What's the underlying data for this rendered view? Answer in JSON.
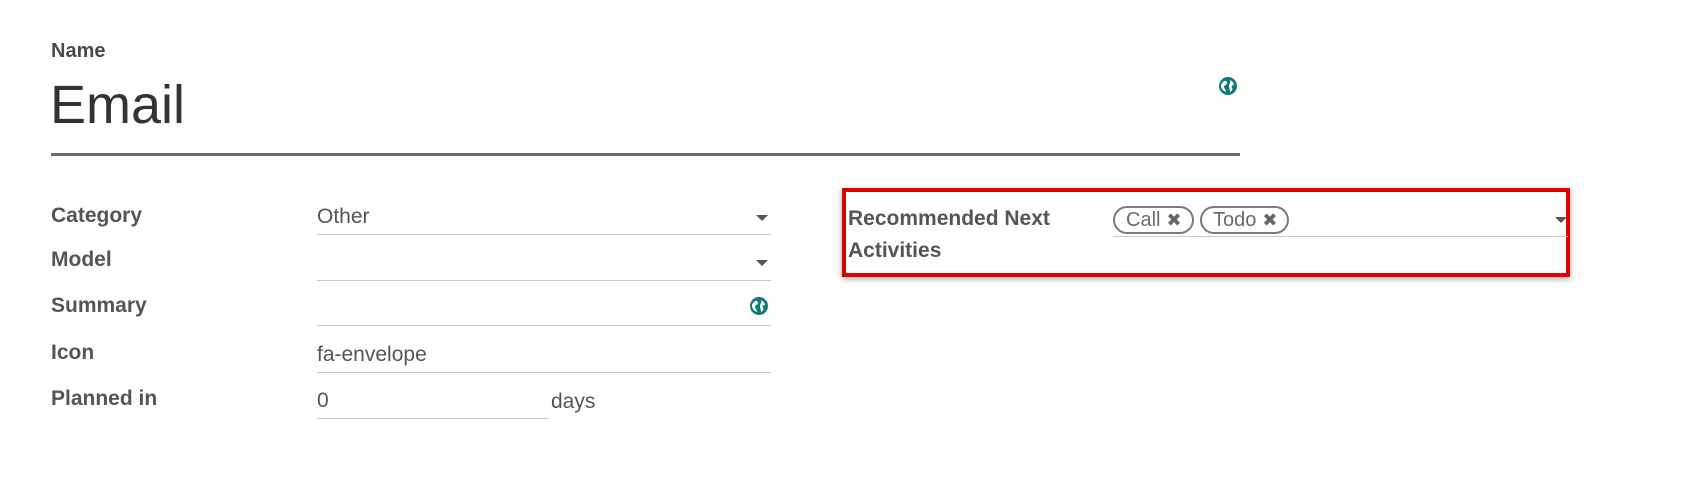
{
  "name": {
    "label": "Name",
    "value": "Email"
  },
  "fields": {
    "category": {
      "label": "Category",
      "value": "Other"
    },
    "model": {
      "label": "Model",
      "value": ""
    },
    "summary": {
      "label": "Summary",
      "value": ""
    },
    "icon": {
      "label": "Icon",
      "value": "fa-envelope"
    },
    "planned_in": {
      "label": "Planned in",
      "value": "0",
      "unit": "days"
    }
  },
  "recommended": {
    "label_line1": "Recommended Next",
    "label_line2": "Activities",
    "tags": [
      "Call",
      "Todo"
    ],
    "remove_symbol": "✖"
  },
  "icons": {
    "translate": "globe-icon",
    "dropdown": "caret-down-icon",
    "remove": "remove-tag-icon"
  },
  "colors": {
    "accent": "#00a09d",
    "highlight": "#e00000"
  }
}
